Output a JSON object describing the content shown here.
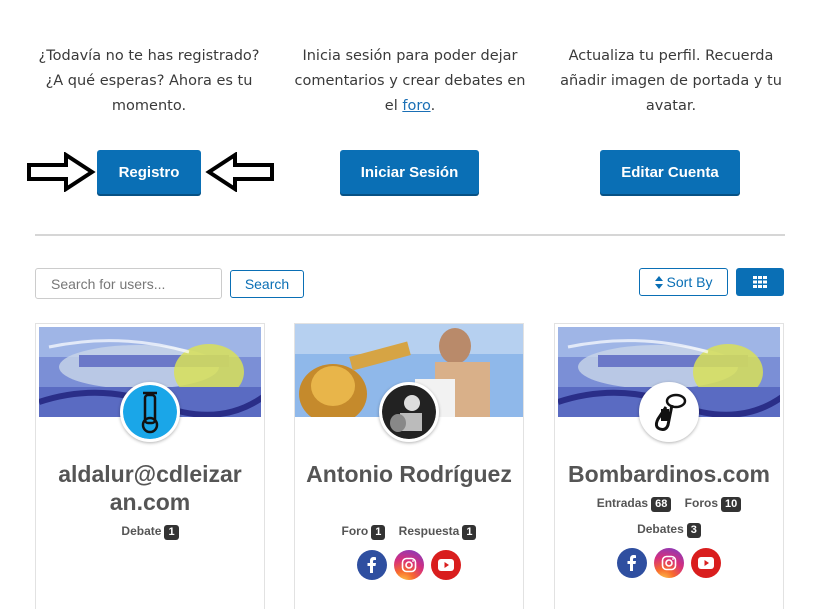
{
  "intro": {
    "col1": "¿Todavía no te has registrado? ¿A qué esperas? Ahora es tu momento.",
    "col2_before": "Inicia sesión para poder dejar comentarios y crear debates en el ",
    "col2_link": "foro",
    "col2_after": ".",
    "col3": "Actualiza tu perfil. Recuerda añadir imagen de portada y tu avatar."
  },
  "buttons": {
    "register": "Registro",
    "login": "Iniciar Sesión",
    "edit": "Editar Cuenta"
  },
  "toolbar": {
    "search_placeholder": "Search for users...",
    "search_label": "Search",
    "sort_label": "Sort By"
  },
  "users": [
    {
      "name": "aldalur@cdleizar an.com",
      "stats": [
        {
          "label": "Debate",
          "count": "1"
        }
      ]
    },
    {
      "name": "Antonio Rodríguez",
      "stats": [
        {
          "label": "Foro",
          "count": "1"
        },
        {
          "label": "Respuesta",
          "count": "1"
        }
      ]
    },
    {
      "name": "Bombardinos.com",
      "stats": [
        {
          "label": "Entradas",
          "count": "68"
        },
        {
          "label": "Foros",
          "count": "10"
        },
        {
          "label": "Debates",
          "count": "3"
        }
      ]
    }
  ],
  "colors": {
    "primary": "#0a6fb5",
    "facebook": "#2f4fa0",
    "youtube": "#d91e1e"
  },
  "icons": [
    "arrow-right-icon",
    "arrow-left-icon",
    "sort-icon",
    "grid-icon",
    "facebook-icon",
    "instagram-icon",
    "youtube-icon"
  ]
}
